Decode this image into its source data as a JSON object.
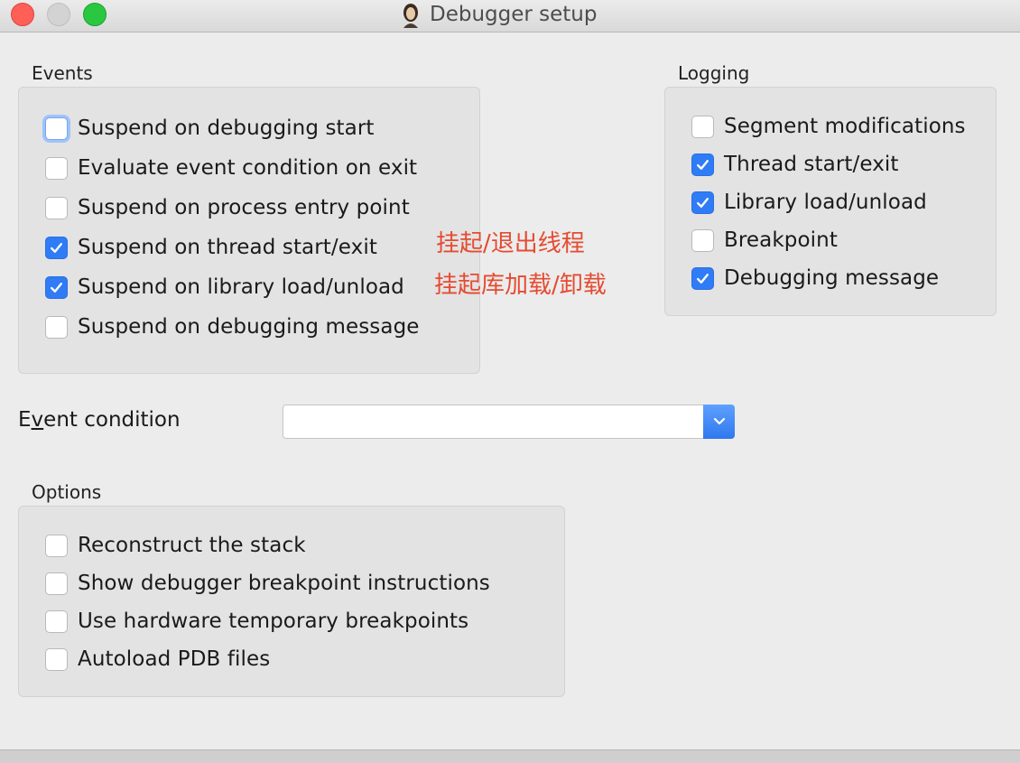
{
  "window": {
    "title": "Debugger setup"
  },
  "events": {
    "label": "Events",
    "items": [
      {
        "label": "Suspend on debugging start",
        "checked": false
      },
      {
        "label": "Evaluate event condition on exit",
        "checked": false
      },
      {
        "label": "Suspend on process entry point",
        "checked": false
      },
      {
        "label": "Suspend on thread start/exit",
        "checked": true
      },
      {
        "label": "Suspend on library load/unload",
        "checked": true
      },
      {
        "label": "Suspend on debugging message",
        "checked": false
      }
    ]
  },
  "annotations": {
    "thread": "挂起/退出线程",
    "library": "挂起库加载/卸载",
    "color": "#e54b32"
  },
  "logging": {
    "label": "Logging",
    "items": [
      {
        "label": "Segment modifications",
        "checked": false
      },
      {
        "label": "Thread start/exit",
        "checked": true
      },
      {
        "label": "Library load/unload",
        "checked": true
      },
      {
        "label": "Breakpoint",
        "checked": false
      },
      {
        "label": "Debugging message",
        "checked": true
      }
    ]
  },
  "event_condition": {
    "label_pre": "E",
    "label_u": "v",
    "label_post": "ent condition",
    "value": ""
  },
  "options": {
    "label": "Options",
    "items": [
      {
        "label": "Reconstruct the stack",
        "checked": false
      },
      {
        "label": "Show debugger breakpoint instructions",
        "checked": false
      },
      {
        "label": "Use hardware temporary breakpoints",
        "checked": false
      },
      {
        "label": "Autoload PDB files",
        "checked": false
      }
    ]
  },
  "colors": {
    "accent": "#2f7cf6",
    "panel": "#e3e3e3",
    "window_bg": "#ececec"
  }
}
